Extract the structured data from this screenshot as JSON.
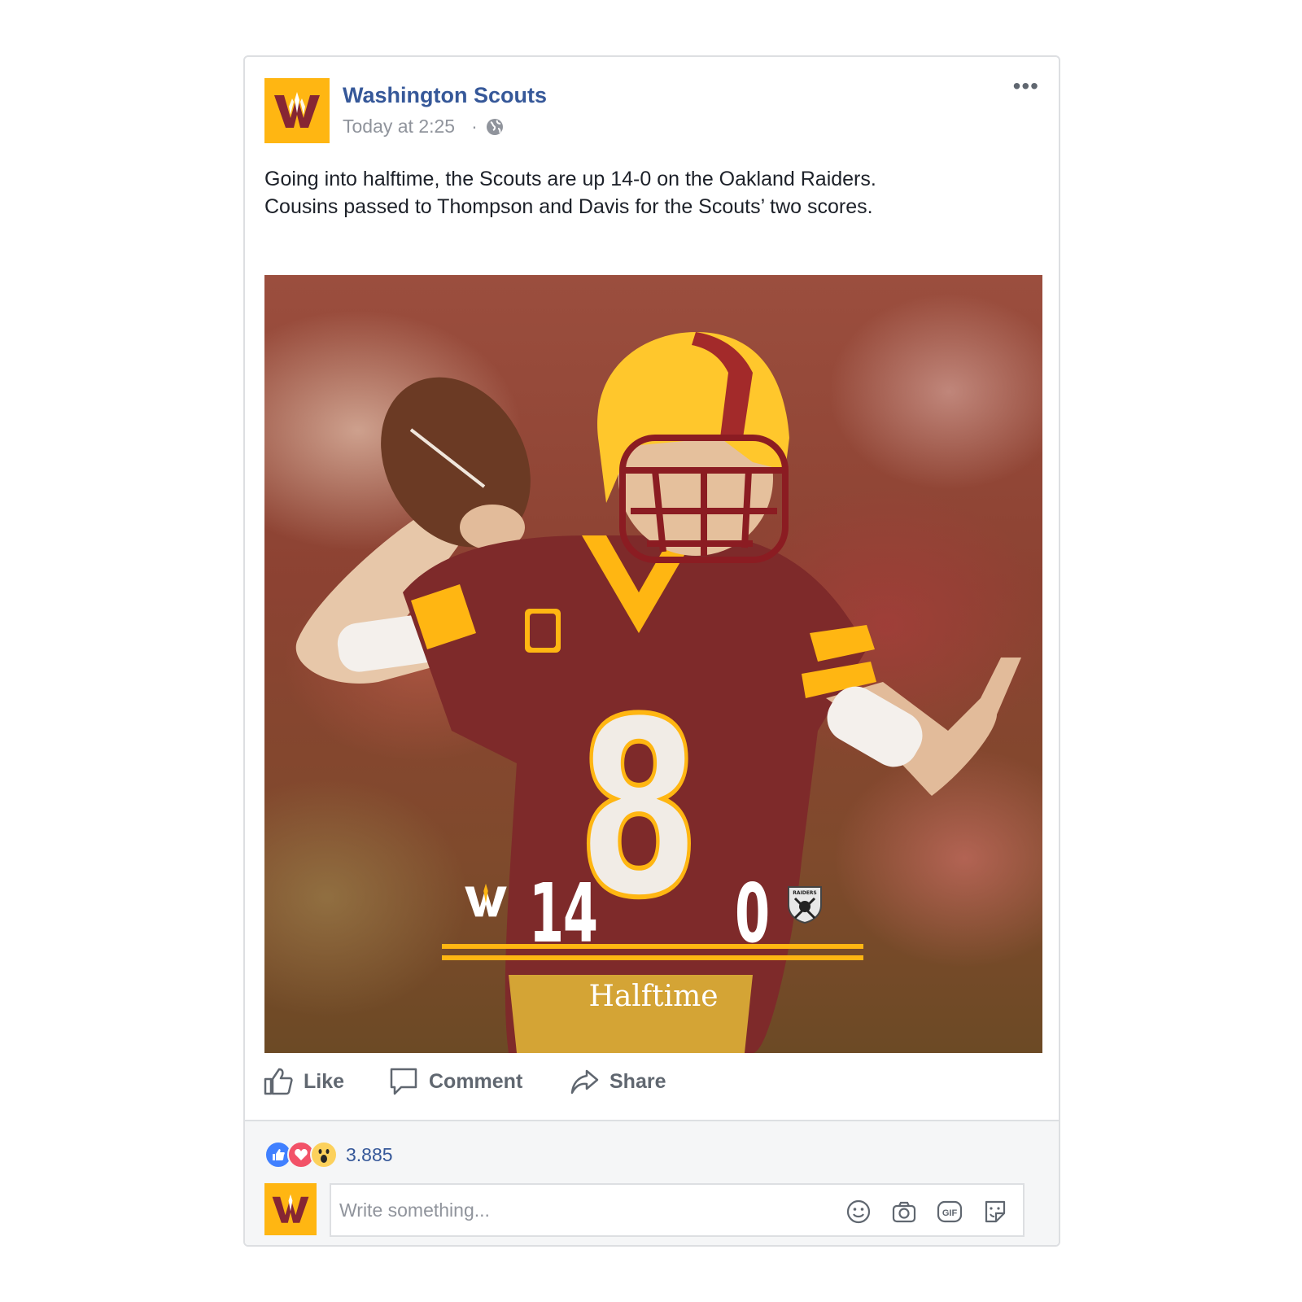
{
  "post": {
    "page_name": "Washington Scouts",
    "timestamp": "Today at 2:25",
    "separator": "·",
    "more_label": "•••",
    "text_line1": "Going into halftime, the Scouts are up 14-0 on the Oakland Raiders.",
    "text_line2": "Cousins passed to Thompson and Davis for the Scouts’ two scores."
  },
  "photo": {
    "home_score": "14",
    "away_score": "0",
    "status": "Halftime",
    "jersey_number": "8",
    "away_badge_text": "RAIDERS"
  },
  "actions": {
    "like": "Like",
    "comment": "Comment",
    "share": "Share"
  },
  "footer": {
    "reaction_count": "3.885",
    "comment_placeholder": "Write something..."
  },
  "colors": {
    "brand_gold": "#ffb612",
    "brand_burgundy": "#862633",
    "link_blue": "#365899"
  },
  "icons": [
    "scouts-logo",
    "globe-icon",
    "more-icon",
    "like-icon",
    "comment-icon",
    "share-icon",
    "like-reaction-icon",
    "love-reaction-icon",
    "wow-reaction-icon",
    "emoji-icon",
    "camera-icon",
    "gif-icon",
    "sticker-icon"
  ]
}
